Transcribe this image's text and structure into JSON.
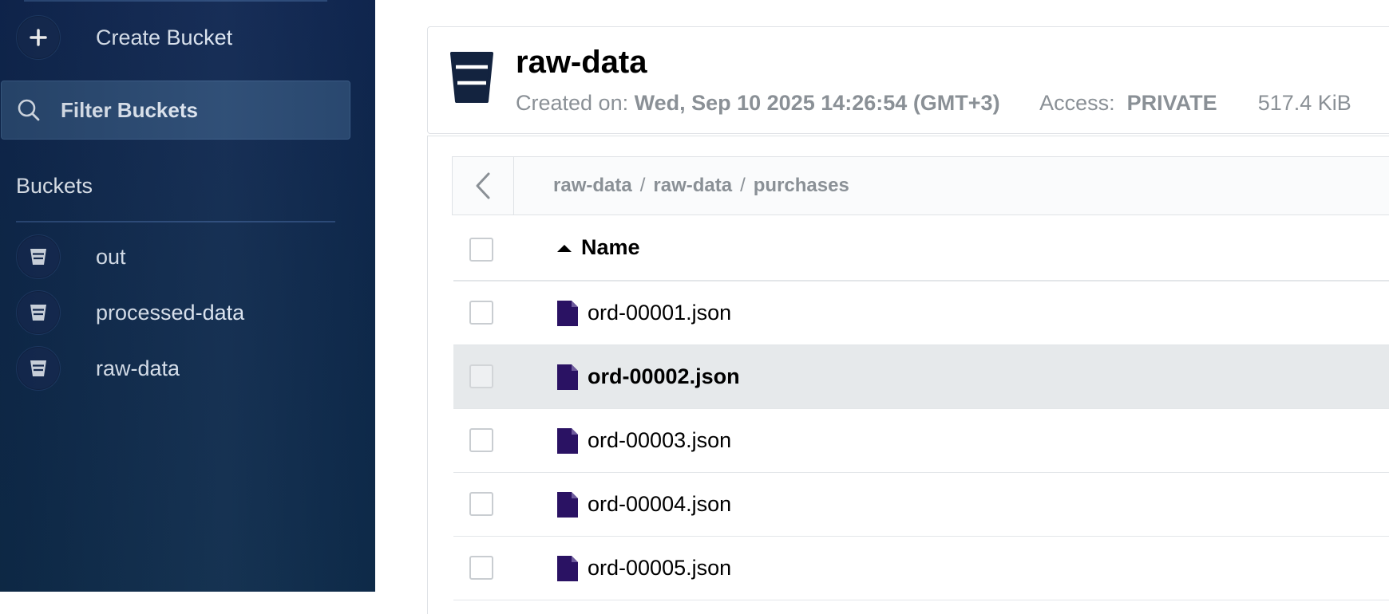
{
  "sidebar": {
    "create_bucket_label": "Create Bucket",
    "filter_placeholder": "Filter Buckets",
    "buckets_title": "Buckets",
    "buckets": [
      {
        "label": "out"
      },
      {
        "label": "processed-data"
      },
      {
        "label": "raw-data"
      }
    ]
  },
  "header": {
    "bucket_name": "raw-data",
    "created_label": "Created on:",
    "created_value": "Wed, Sep 10 2025 14:26:54 (GMT+3)",
    "access_label": "Access:",
    "access_value": "PRIVATE",
    "size": "517.4 KiB"
  },
  "breadcrumb": {
    "parts": [
      "raw-data",
      "raw-data",
      "purchases"
    ],
    "separator": "/"
  },
  "table": {
    "name_header": "Name",
    "sort_direction": "ascending",
    "rows": [
      {
        "name": "ord-00001.json",
        "selected": false
      },
      {
        "name": "ord-00002.json",
        "selected": true
      },
      {
        "name": "ord-00003.json",
        "selected": false
      },
      {
        "name": "ord-00004.json",
        "selected": false
      },
      {
        "name": "ord-00005.json",
        "selected": false
      }
    ]
  },
  "colors": {
    "sidebar_bg": "#102752",
    "file_icon": "#2a1263",
    "bucket_icon": "#13233f",
    "selected_row": "#e6e9eb"
  }
}
